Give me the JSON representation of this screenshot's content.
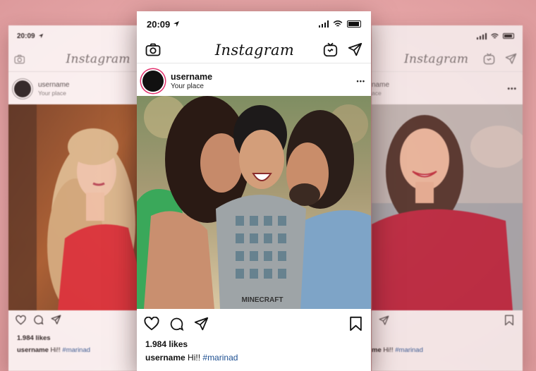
{
  "left_phone": {
    "time": "20:09",
    "logo": "Instagram",
    "username": "username",
    "place": "Your place",
    "likes": "1.984 likes",
    "caption_user": "username",
    "caption_text": "Hi!!",
    "caption_tag": "#marinad"
  },
  "center_phone": {
    "time": "20:09",
    "logo": "Instagram",
    "username": "username",
    "place": "Your place",
    "more": "•••",
    "likes": "1.984 likes",
    "caption_user": "username",
    "caption_text": "Hi!!",
    "caption_tag": "#marinad",
    "shirt_text": "MINECRAFT"
  },
  "right_phone": {
    "logo": "Instagram",
    "username_partial": "name",
    "place_partial": "ace",
    "more": "•••",
    "caption_user_partial": "me",
    "caption_text": "Hi!!",
    "caption_tag": "#marinad"
  },
  "colors": {
    "background": "#eab0b1",
    "story_ring": "#e1306c",
    "hashtag": "#1d4f91",
    "dress_red": "#d81f27",
    "sweater_red": "#b3142e"
  },
  "icons": [
    "camera-icon",
    "igtv-icon",
    "send-icon",
    "heart-icon",
    "comment-icon",
    "share-icon",
    "bookmark-icon",
    "location-arrow-icon",
    "signal-icon",
    "wifi-icon",
    "battery-icon"
  ]
}
